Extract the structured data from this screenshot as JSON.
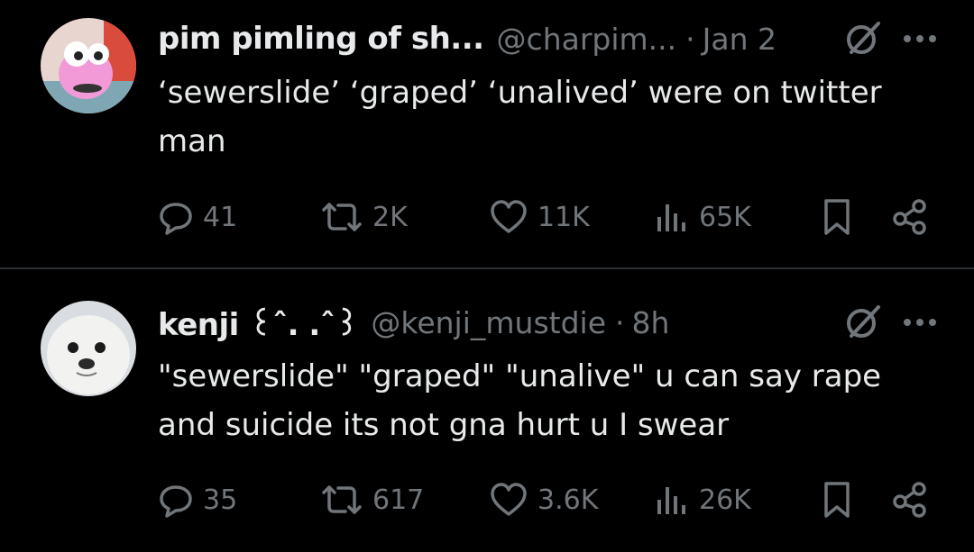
{
  "tweets": [
    {
      "author_name": "pim pimling of sh...",
      "handle": "@charpim...",
      "separator": "·",
      "time": "Jan 2",
      "text": "‘sewerslide’ ‘graped’ ‘unalived’ were on twitter man",
      "reply_count": "41",
      "repost_count": "2K",
      "like_count": "11K",
      "view_count": "65K"
    },
    {
      "author_name": "kenji ꒰ˆ. .ˆ꒱",
      "handle": "@kenji_mustdie",
      "separator": "·",
      "time": "8h",
      "text": "\"sewerslide\" \"graped\" \"unalive\" u can say rape and suicide its not gna hurt u I swear",
      "reply_count": "35",
      "repost_count": "617",
      "like_count": "3.6K",
      "view_count": "26K"
    }
  ],
  "colors": {
    "background": "#000000",
    "primary_text": "#e7e9ea",
    "secondary_text": "#71767b",
    "divider": "#2f3336"
  },
  "icons": [
    "grok-icon",
    "more-icon",
    "reply-icon",
    "repost-icon",
    "like-icon",
    "views-icon",
    "bookmark-icon",
    "share-icon"
  ]
}
